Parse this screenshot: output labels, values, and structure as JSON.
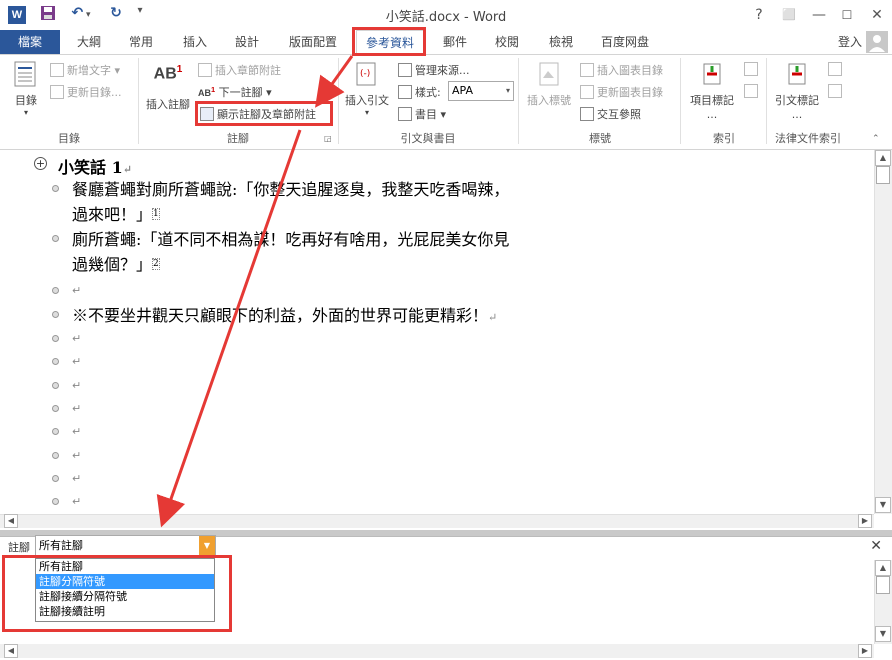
{
  "window": {
    "title": "小笑話.docx - Word",
    "help": "?",
    "restore": "⬜",
    "minimize": "—",
    "maximize": "☐",
    "close": "✕"
  },
  "quick_access": {
    "logo": "W",
    "save": "💾",
    "undo": "↶",
    "redo": "↻",
    "customize": "▾"
  },
  "tabs": [
    {
      "label": "檔案"
    },
    {
      "label": "大綱"
    },
    {
      "label": "常用"
    },
    {
      "label": "插入"
    },
    {
      "label": "設計"
    },
    {
      "label": "版面配置"
    },
    {
      "label": "參考資料"
    },
    {
      "label": "郵件"
    },
    {
      "label": "校閱"
    },
    {
      "label": "檢視"
    },
    {
      "label": "百度网盘"
    }
  ],
  "account": {
    "login": "登入"
  },
  "ribbon": {
    "toc": {
      "button": "目錄",
      "add_text": "新增文字",
      "update": "更新目錄...",
      "group": "目錄"
    },
    "footnotes": {
      "insert": "插入註腳",
      "insert_endnote": "插入章節附註",
      "next": "下一註腳",
      "show": "顯示註腳及章節附註",
      "group": "註腳",
      "big_icon_text": "AB",
      "big_icon_sup": "1",
      "next_icon": "AB",
      "next_sup": "1"
    },
    "citations": {
      "insert": "插入引文",
      "manage": "管理來源...",
      "style_label": "樣式:",
      "style_value": "APA",
      "bibliography": "書目",
      "group": "引文與書目"
    },
    "captions": {
      "insert": "插入標號",
      "insert_table": "插入圖表目錄",
      "update_table": "更新圖表目錄",
      "cross_ref": "交互參照",
      "group": "標號"
    },
    "index": {
      "mark": "項目標記",
      "more": "...",
      "group": "索引"
    },
    "authorities": {
      "mark": "引文標記",
      "more": "...",
      "group": "法律文件索引"
    }
  },
  "document": {
    "heading": "小笑話 1",
    "lines": [
      "餐廳蒼蠅對廁所蒼蠅說:「你整天追腥逐臭，我整天吃香喝辣，",
      "過來吧！」",
      "廁所蒼蠅:「道不同不相為謀！吃再好有啥用，光屁屁美女你見",
      "過幾個？」",
      "※不要坐井觀天只顧眼下的利益，外面的世界可能更精彩！"
    ],
    "para_mark": "↵",
    "footnote_ref1": "1",
    "footnote_ref2": "2"
  },
  "footnote_pane": {
    "label": "註腳",
    "selected": "所有註腳",
    "options": [
      "所有註腳",
      "註腳分隔符號",
      "註腳接續分隔符號",
      "註腳接續註明"
    ],
    "highlighted_index": 1,
    "close": "✕"
  },
  "colors": {
    "accent": "#2b579a",
    "annotation": "#e53935",
    "highlight": "#3399ff"
  }
}
